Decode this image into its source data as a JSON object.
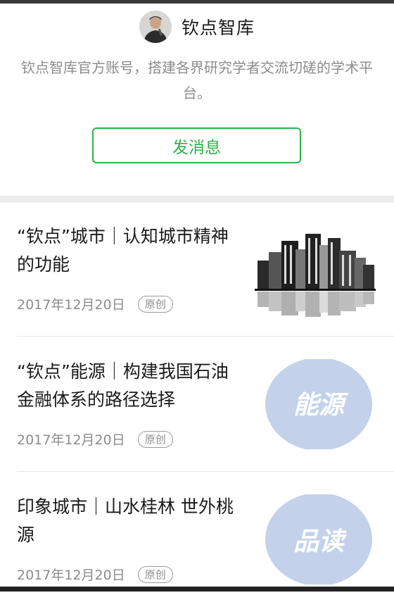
{
  "account": {
    "name": "钦点智库",
    "description": "钦点智库官方账号，搭建各界研究学者交流切磋的学术平台。",
    "send_message_label": "发消息"
  },
  "articles": [
    {
      "title": "“钦点”城市｜认知城市精神的功能",
      "date": "2017年12月20日",
      "badge": "原创",
      "thumb_icon": "city-skyline-image"
    },
    {
      "title": "“钦点”能源｜构建我国石油金融体系的路径选择",
      "date": "2017年12月20日",
      "badge": "原创",
      "thumb_icon": "energy-calligraphy-image",
      "thumb_text": "能源"
    },
    {
      "title": "印象城市｜山水桂林 世外桃源",
      "date": "2017年12月20日",
      "badge": "原创",
      "thumb_icon": "pinread-calligraphy-image",
      "thumb_text": "品读"
    }
  ],
  "colors": {
    "accent": "#2fb24a",
    "thumb_circle": "#c3d2ea"
  }
}
